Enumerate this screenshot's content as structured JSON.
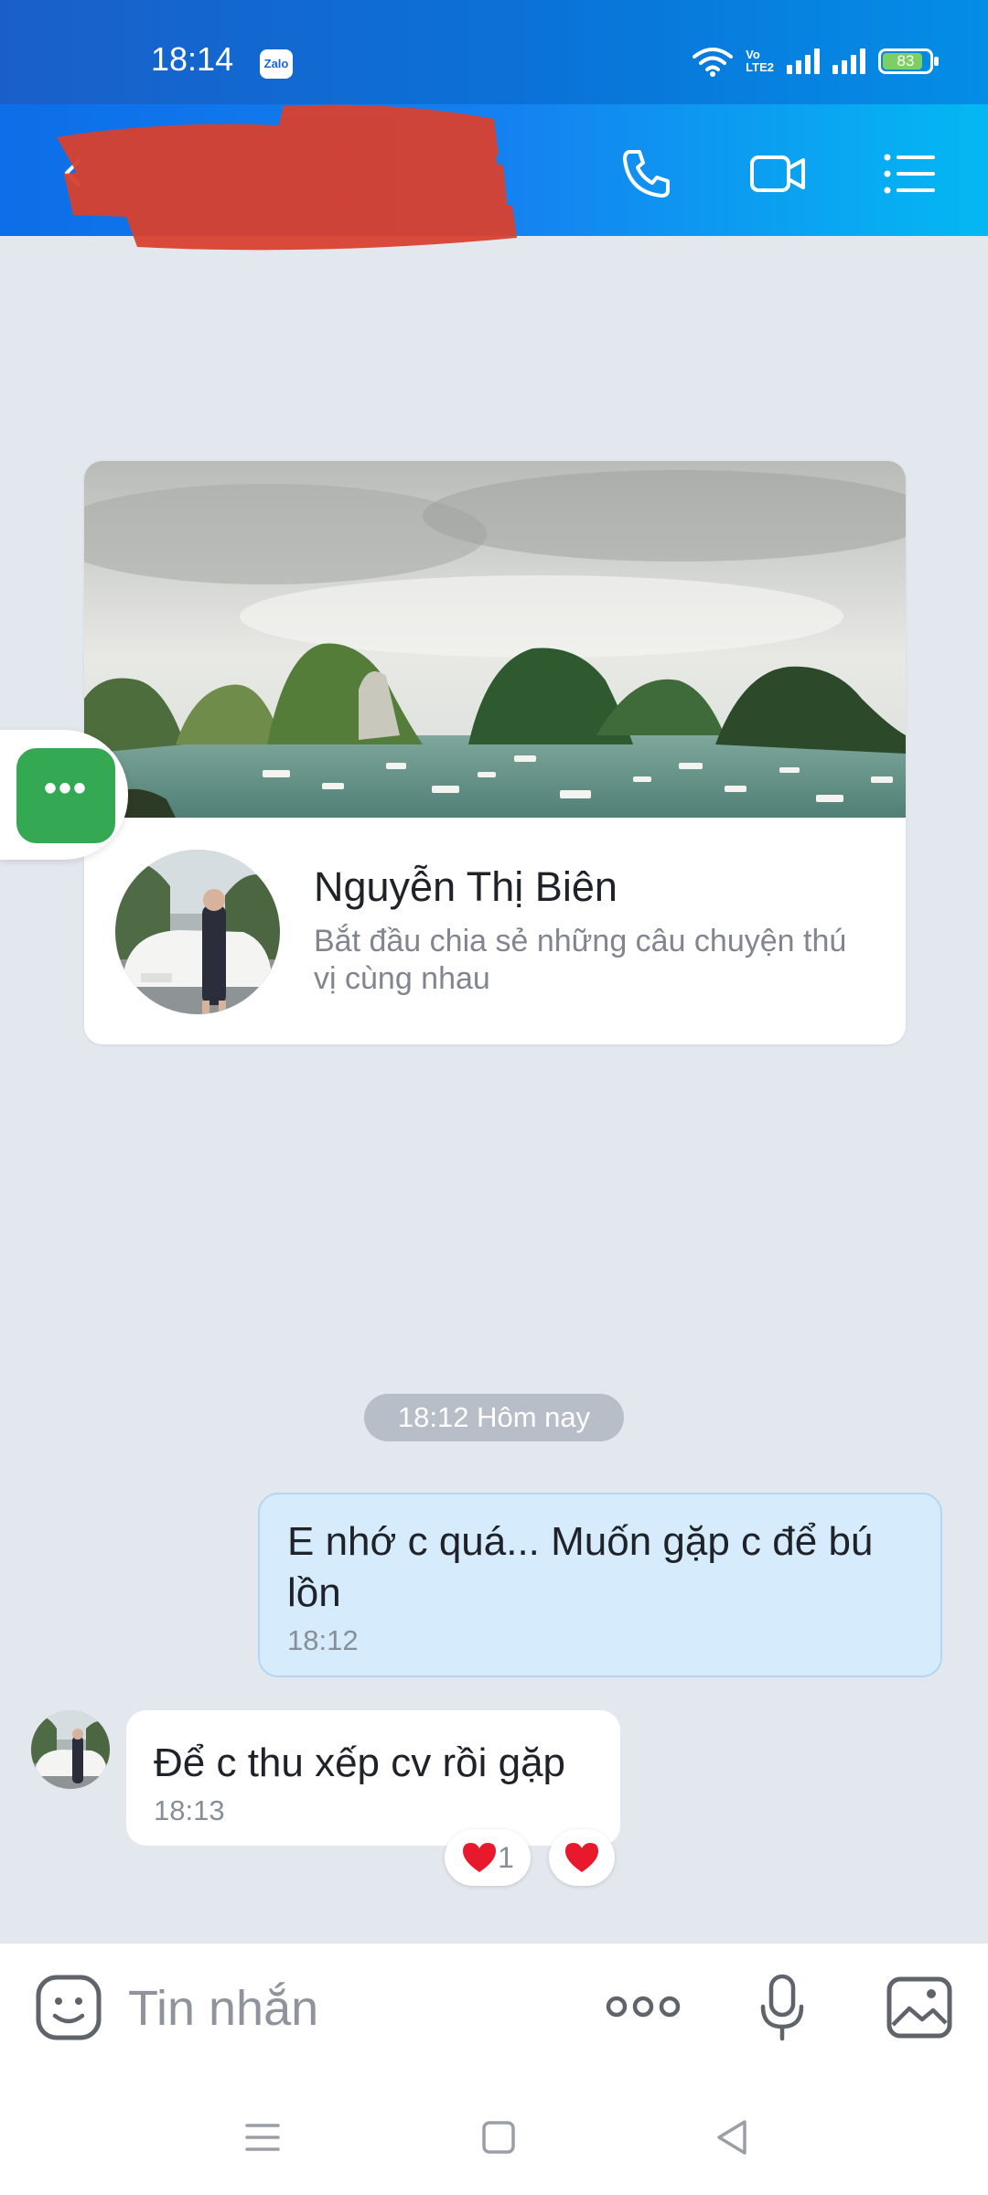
{
  "status_bar": {
    "time": "18:14",
    "app_badge": "Zalo",
    "network_label": "VoLTE2",
    "battery_level": "83"
  },
  "header": {
    "back_icon": "back-arrow-icon",
    "call_icon": "phone-icon",
    "video_icon": "video-camera-icon",
    "menu_icon": "list-menu-icon"
  },
  "profile_card": {
    "name": "Nguyễn Thị Biên",
    "subtitle": "Bắt đầu chia sẻ những câu chuyện thú vị cùng nhau"
  },
  "date_divider": "18:12 Hôm nay",
  "messages": [
    {
      "direction": "outgoing",
      "text": "E nhớ c quá... Muốn gặp c để bú lồn",
      "time": "18:12"
    },
    {
      "direction": "incoming",
      "text": "Để c thu xếp cv rồi gặp",
      "time": "18:13"
    }
  ],
  "reactions": {
    "count": "1",
    "color": "#e8192c"
  },
  "composer": {
    "placeholder": "Tin nhắn"
  },
  "colors": {
    "header_start": "#0c6ee8",
    "header_end": "#03b8f2",
    "outgoing_bubble": "#d6ecfd",
    "background": "#e3e7ee",
    "float_button": "#34a853"
  }
}
